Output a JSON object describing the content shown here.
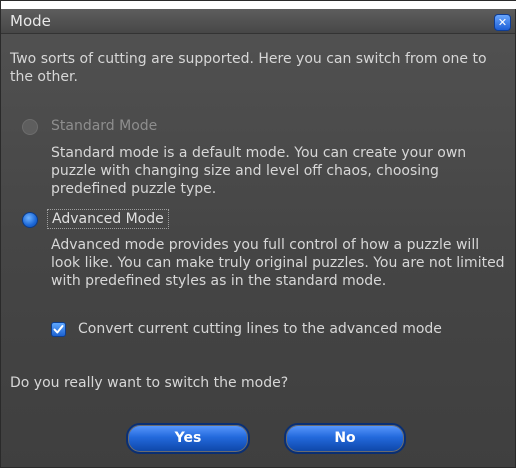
{
  "dialog": {
    "title": "Mode",
    "close_glyph": "✕",
    "intro": "Two sorts of cutting are supported. Here you can switch from one to the other.",
    "standard": {
      "label": "Standard Mode",
      "selected": false,
      "description": "Standard mode is a default mode. You can create your own puzzle with changing size and level off chaos, choosing predefined puzzle type."
    },
    "advanced": {
      "label": "Advanced Mode",
      "selected": true,
      "description": "Advanced mode provides you full control of how a puzzle will look like. You can make truly original puzzles. You are not limited with predefined styles as in the standard mode."
    },
    "convert_checkbox": {
      "label": "Convert current cutting lines to the advanced mode",
      "checked": true
    },
    "question": "Do you really want to switch the mode?",
    "buttons": {
      "yes": "Yes",
      "no": "No"
    }
  },
  "colors": {
    "background": "#484848",
    "accent": "#1f66d8",
    "text": "#d7d7d7"
  },
  "icons": {
    "close": "close-icon",
    "check": "checkmark-icon"
  }
}
